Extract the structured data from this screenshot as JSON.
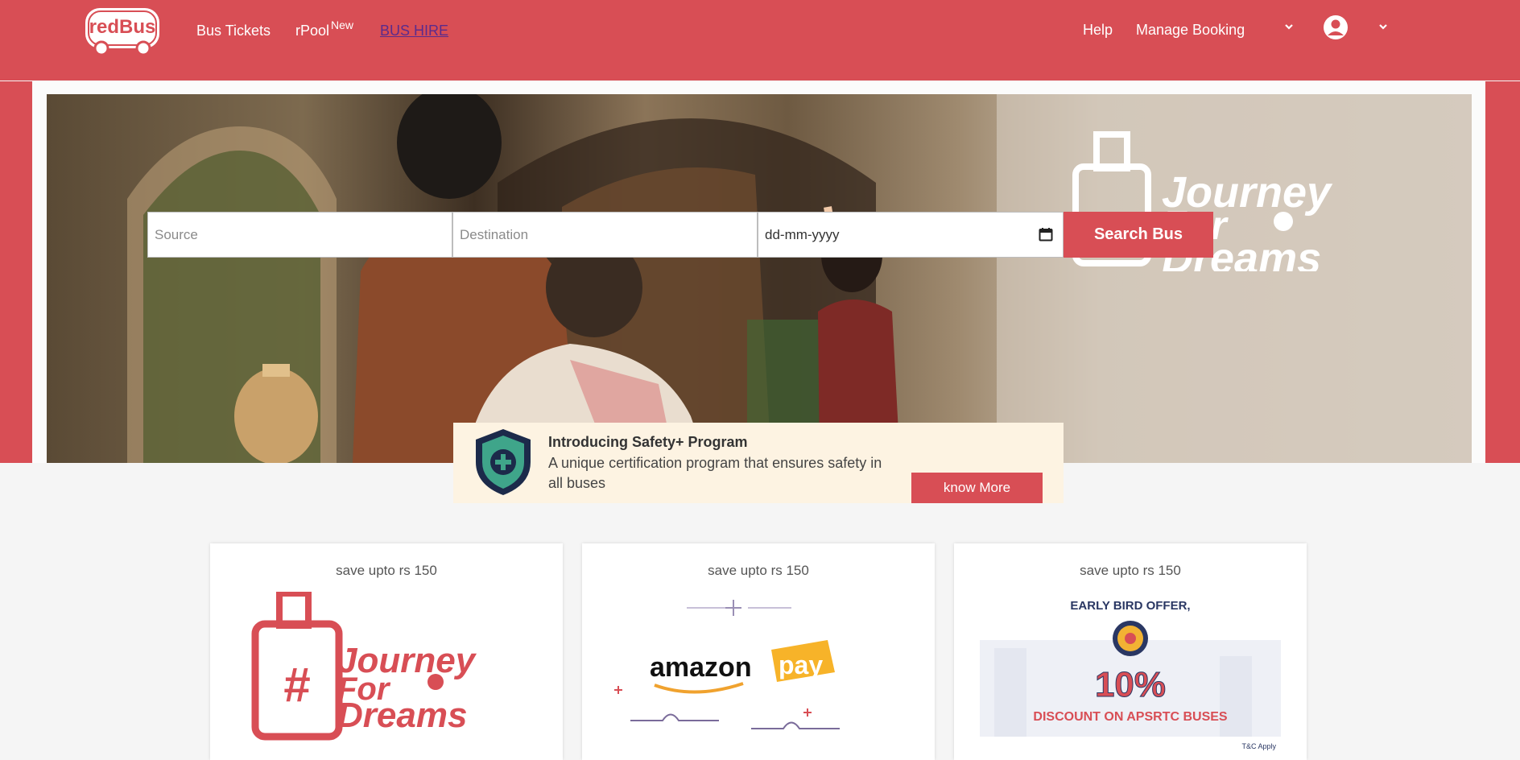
{
  "brand": {
    "name": "redBus",
    "color": "#d84e55"
  },
  "nav": {
    "bus_tickets": "Bus Tickets",
    "rpool": "rPool",
    "rpool_badge": "New",
    "bus_hire": "BUS HIRE",
    "help": "Help",
    "manage_booking": "Manage Booking"
  },
  "search": {
    "source_placeholder": "Source",
    "destination_placeholder": "Destination",
    "date_value": "dd-mm-yyyy",
    "button": "Search Bus"
  },
  "hero": {
    "brand_line1": "Journey",
    "brand_line2": "For",
    "brand_line3": "Dreams"
  },
  "safety": {
    "title": "Introducing Safety+ Program",
    "description": "A unique certification program that ensures safety in all buses",
    "button": "know More"
  },
  "offers": [
    {
      "caption": "save upto rs 150",
      "art": "journey-for-dreams",
      "art_lines": [
        "Journey",
        "For",
        "Dreams"
      ]
    },
    {
      "caption": "save upto rs 150",
      "art": "amazon-pay",
      "art_lines": [
        "amazon",
        "pay"
      ]
    },
    {
      "caption": "save upto rs 150",
      "art": "early-bird-apsrtc",
      "art_lines": [
        "EARLY BIRD OFFER,",
        "10%",
        "DISCOUNT ON APSRTC BUSES",
        "T&C Apply"
      ]
    }
  ]
}
